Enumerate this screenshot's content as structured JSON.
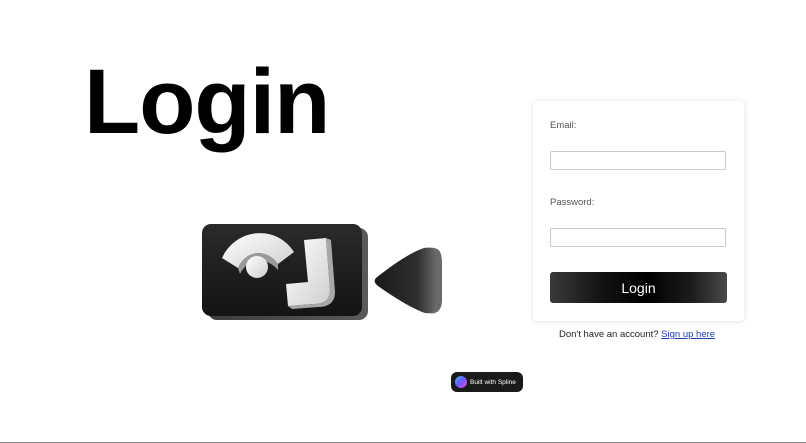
{
  "hero": {
    "title": "Login"
  },
  "scene": {
    "icon": "video-camera-3d-icon",
    "colors": {
      "body": "#1c1c1c",
      "shapes": "#f2f2f2",
      "lens": "#2a2a2a"
    }
  },
  "form": {
    "email_label": "Email:",
    "email_value": "",
    "password_label": "Password:",
    "password_value": "",
    "submit_label": "Login"
  },
  "signup": {
    "prompt": "Don't have an account?",
    "link_label": "Sign up here",
    "link_color": "#1b3fae"
  },
  "badge": {
    "label": "Built with Spline",
    "icon": "spline-logo-icon"
  }
}
